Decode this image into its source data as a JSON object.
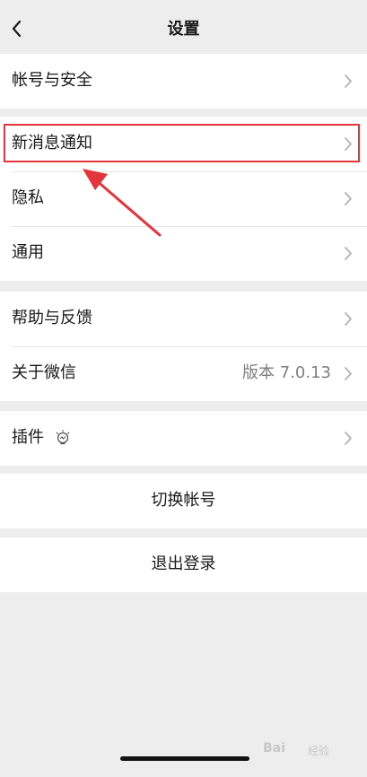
{
  "header": {
    "title": "设置"
  },
  "groups": [
    {
      "items": [
        {
          "label": "帐号与安全"
        }
      ]
    },
    {
      "items": [
        {
          "label": "新消息通知"
        },
        {
          "label": "隐私"
        },
        {
          "label": "通用"
        }
      ]
    },
    {
      "items": [
        {
          "label": "帮助与反馈"
        },
        {
          "label": "关于微信",
          "value": "版本 7.0.13"
        }
      ]
    },
    {
      "items": [
        {
          "label": "插件"
        }
      ]
    }
  ],
  "actions": {
    "switch_account": "切换帐号",
    "logout": "退出登录"
  },
  "colors": {
    "background": "#ededed",
    "row": "#ffffff",
    "highlight": "#e5343b",
    "secondary_text": "#7f7f7f"
  },
  "icons": {
    "back": "chevron-left-icon",
    "row_chevron": "chevron-right-icon",
    "plugin": "lightbulb-icon"
  },
  "watermark": {
    "brand": "Bai",
    "sub": "经验"
  }
}
